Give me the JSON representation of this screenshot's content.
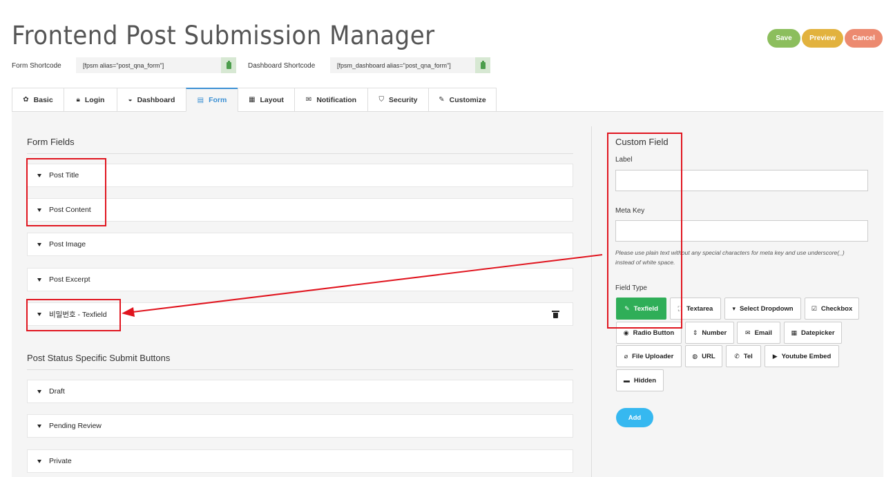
{
  "page": {
    "title": "Frontend Post Submission Manager"
  },
  "actions": {
    "save": "Save",
    "preview": "Preview",
    "cancel": "Cancel"
  },
  "shortcodes": {
    "form_label": "Form Shortcode",
    "form_value": "[fpsm alias=\"post_qna_form\"]",
    "dashboard_label": "Dashboard Shortcode",
    "dashboard_value": "[fpsm_dashboard alias=\"post_qna_form\"]"
  },
  "tabs": [
    {
      "label": "Basic",
      "icon": "gear-icon",
      "glyph": "✿"
    },
    {
      "label": "Login",
      "icon": "lock-icon",
      "glyph": "🔒︎"
    },
    {
      "label": "Dashboard",
      "icon": "dashboard-icon",
      "glyph": "◒"
    },
    {
      "label": "Form",
      "icon": "form-icon",
      "glyph": "▤"
    },
    {
      "label": "Layout",
      "icon": "layout-icon",
      "glyph": "▦"
    },
    {
      "label": "Notification",
      "icon": "envelope-icon",
      "glyph": "✉"
    },
    {
      "label": "Security",
      "icon": "shield-icon",
      "glyph": "⛉"
    },
    {
      "label": "Customize",
      "icon": "brush-icon",
      "glyph": "✎"
    }
  ],
  "active_tab": "Form",
  "form_fields": {
    "title": "Form Fields",
    "items": [
      "Post Title",
      "Post Content",
      "Post Image",
      "Post Excerpt",
      "비밀번호 - Texfield"
    ]
  },
  "submit_buttons": {
    "title": "Post Status Specific Submit Buttons",
    "items": [
      "Draft",
      "Pending Review",
      "Private"
    ]
  },
  "custom_field": {
    "title": "Custom Field",
    "label_label": "Label",
    "label_value": "",
    "meta_key_label": "Meta Key",
    "meta_key_value": "",
    "help_text": "Please use plain text without any special characters for meta key and use underscore(_) instead of white space.",
    "field_type_label": "Field Type",
    "field_types": [
      {
        "label": "Texfield",
        "icon": "edit-icon",
        "glyph": "✎"
      },
      {
        "label": "Textarea",
        "icon": "expand-icon",
        "glyph": "⛶"
      },
      {
        "label": "Select Dropdown",
        "icon": "caret-square-icon",
        "glyph": "▾"
      },
      {
        "label": "Checkbox",
        "icon": "checkbox-icon",
        "glyph": "☑"
      },
      {
        "label": "Radio Button",
        "icon": "radio-icon",
        "glyph": "◉"
      },
      {
        "label": "Number",
        "icon": "sort-icon",
        "glyph": "⇕"
      },
      {
        "label": "Email",
        "icon": "envelope-icon",
        "glyph": "✉"
      },
      {
        "label": "Datepicker",
        "icon": "calendar-icon",
        "glyph": "▦"
      },
      {
        "label": "File Uploader",
        "icon": "paperclip-icon",
        "glyph": "⌀"
      },
      {
        "label": "URL",
        "icon": "globe-icon",
        "glyph": "◍"
      },
      {
        "label": "Tel",
        "icon": "phone-icon",
        "glyph": "✆"
      },
      {
        "label": "Youtube Embed",
        "icon": "youtube-icon",
        "glyph": "▶"
      },
      {
        "label": "Hidden",
        "icon": "minus-square-icon",
        "glyph": "▬"
      }
    ],
    "selected_type": "Texfield",
    "add_label": "Add"
  },
  "colors": {
    "save": "#8cbe5d",
    "preview": "#e2b23e",
    "cancel": "#ec8a70",
    "active_tab": "#3a8fd3",
    "selected_type": "#2fae58",
    "add": "#36b8f0",
    "annotation": "#e0141e"
  }
}
